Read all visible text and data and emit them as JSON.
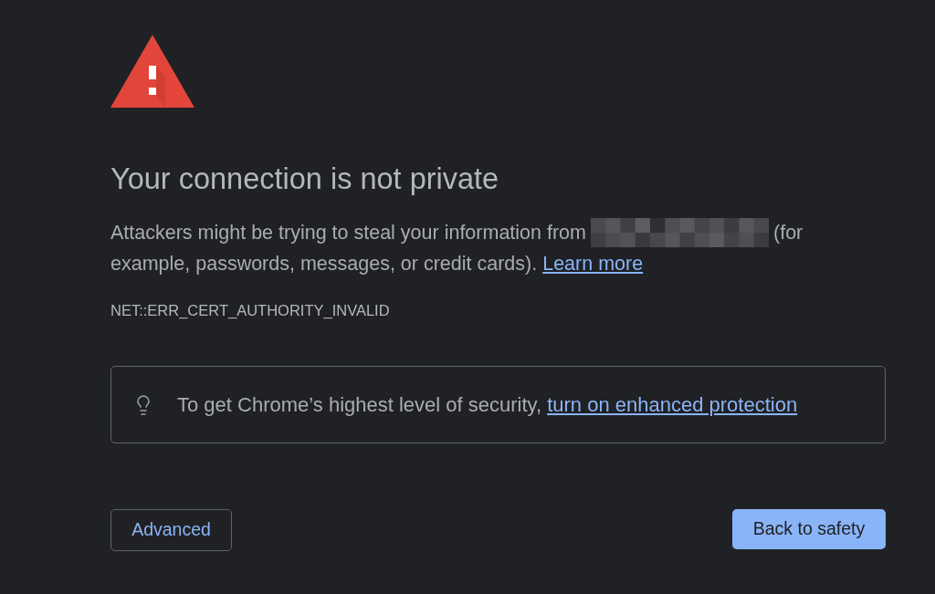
{
  "title": "Your connection is not private",
  "message": {
    "before": "Attackers might be trying to steal your information from",
    "redacted": true,
    "after": "(for example, passwords, messages, or credit cards).",
    "link": "Learn more"
  },
  "error_code": "NET::ERR_CERT_AUTHORITY_INVALID",
  "enhanced_protection": {
    "text": "To get Chrome’s highest level of security,",
    "link": "turn on enhanced protection"
  },
  "buttons": [
    {
      "label": "Advanced",
      "kind": "secondary"
    },
    {
      "label": "Back to safety",
      "kind": "primary"
    }
  ]
}
